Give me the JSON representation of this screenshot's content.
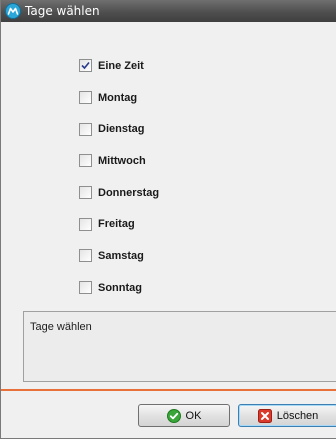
{
  "window": {
    "title": "Tage wählen",
    "app_icon": "app-logo-icon"
  },
  "days": [
    {
      "label": "Eine Zeit",
      "checked": true
    },
    {
      "label": "Montag",
      "checked": false
    },
    {
      "label": "Dienstag",
      "checked": false
    },
    {
      "label": "Mittwoch",
      "checked": false
    },
    {
      "label": "Donnerstag",
      "checked": false
    },
    {
      "label": "Freitag",
      "checked": false
    },
    {
      "label": "Samstag",
      "checked": false
    },
    {
      "label": "Sonntag",
      "checked": false
    }
  ],
  "description": {
    "text": "Tage wählen"
  },
  "buttons": {
    "ok_label": "OK",
    "ok_icon": "green-check-icon",
    "delete_label": "Löschen",
    "delete_icon": "red-x-icon"
  },
  "colors": {
    "separator": "#e8703a",
    "titlebar": "#4f4f4f"
  }
}
